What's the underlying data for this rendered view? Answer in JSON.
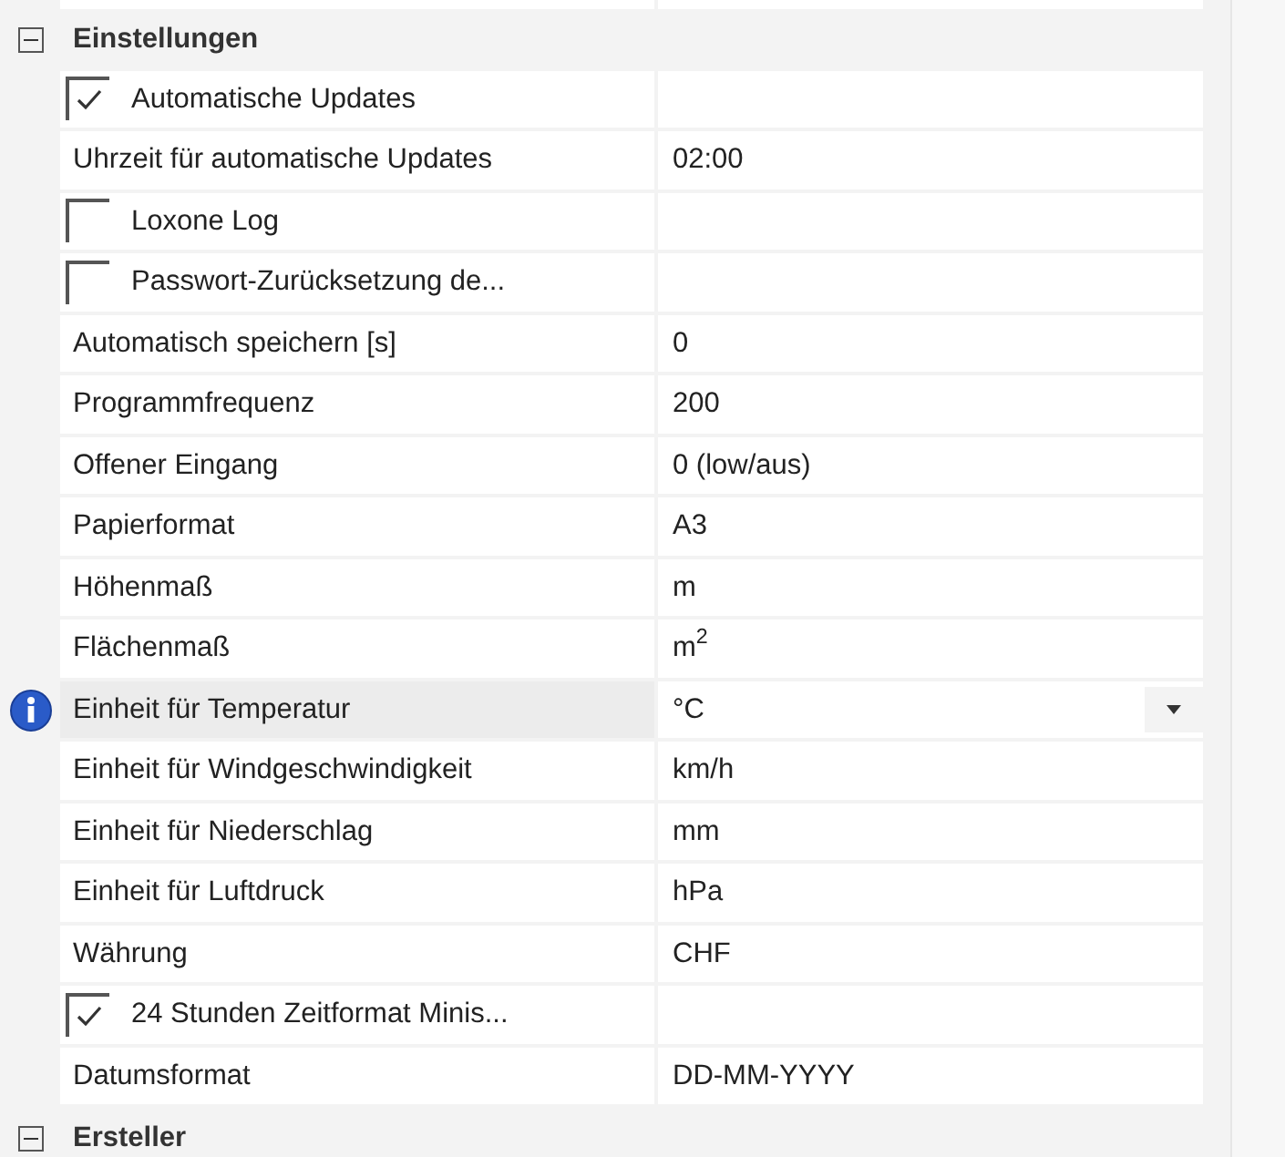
{
  "categories": [
    {
      "title": "Einstellungen",
      "expanded": true,
      "rows": [
        {
          "kind": "checkbox",
          "label": "Automatische Updates",
          "checked": true,
          "selected": false
        },
        {
          "kind": "text",
          "label": "Uhrzeit für automatische Updates",
          "value": "02:00",
          "selected": false
        },
        {
          "kind": "checkbox",
          "label": "Loxone Log",
          "checked": false,
          "selected": false
        },
        {
          "kind": "checkbox",
          "label": "Passwort-Zurücksetzung de...",
          "checked": false,
          "selected": false
        },
        {
          "kind": "text",
          "label": "Automatisch speichern [s]",
          "value": "0",
          "selected": false
        },
        {
          "kind": "text",
          "label": "Programmfrequenz",
          "value": "200",
          "selected": false
        },
        {
          "kind": "text",
          "label": "Offener Eingang",
          "value": "0 (low/aus)",
          "selected": false
        },
        {
          "kind": "text",
          "label": "Papierformat",
          "value": "A3",
          "selected": false
        },
        {
          "kind": "text",
          "label": "Höhenmaß",
          "value": "m",
          "selected": false
        },
        {
          "kind": "text",
          "label": "Flächenmaß",
          "value": "m$^{2}$",
          "selected": false
        },
        {
          "kind": "text",
          "label": "Einheit für Temperatur",
          "value": "°C",
          "selected": true
        },
        {
          "kind": "text",
          "label": "Einheit für Windgeschwindigkeit",
          "value": "km/h",
          "selected": false
        },
        {
          "kind": "text",
          "label": "Einheit für Niederschlag",
          "value": "mm",
          "selected": false
        },
        {
          "kind": "text",
          "label": "Einheit für Luftdruck",
          "value": "hPa",
          "selected": false
        },
        {
          "kind": "text",
          "label": "Währung",
          "value": "CHF",
          "selected": false
        },
        {
          "kind": "checkbox",
          "label": "24 Stunden Zeitformat Minis...",
          "checked": true,
          "selected": false
        },
        {
          "kind": "text",
          "label": "Datumsformat",
          "value": "DD-MM-YYYY",
          "selected": false
        }
      ]
    },
    {
      "title": "Ersteller",
      "expanded": true
    }
  ]
}
